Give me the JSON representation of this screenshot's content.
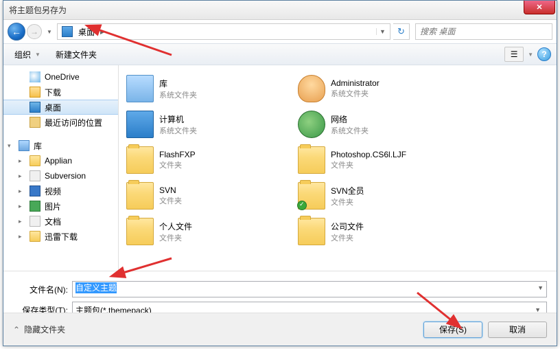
{
  "window": {
    "title": "将主题包另存为"
  },
  "nav": {
    "breadcrumb": "桌面",
    "search_placeholder": "搜索 桌面"
  },
  "toolbar": {
    "organize": "组织",
    "new_folder": "新建文件夹",
    "help": "?"
  },
  "sidebar": {
    "favorites": [
      {
        "label": "OneDrive",
        "icon": "cloud"
      },
      {
        "label": "下载",
        "icon": "down"
      },
      {
        "label": "桌面",
        "icon": "desk",
        "selected": true
      },
      {
        "label": "最近访问的位置",
        "icon": "recent"
      }
    ],
    "libraries_label": "库",
    "libraries": [
      {
        "label": "Applian",
        "icon": "folder"
      },
      {
        "label": "Subversion",
        "icon": "doc"
      },
      {
        "label": "视频",
        "icon": "vid"
      },
      {
        "label": "图片",
        "icon": "pic"
      },
      {
        "label": "文档",
        "icon": "doc"
      },
      {
        "label": "迅雷下载",
        "icon": "folder"
      }
    ]
  },
  "content": {
    "items": [
      {
        "name": "库",
        "sub": "系统文件夹",
        "icon": "lib"
      },
      {
        "name": "Administrator",
        "sub": "系统文件夹",
        "icon": "user"
      },
      {
        "name": "计算机",
        "sub": "系统文件夹",
        "icon": "comp"
      },
      {
        "name": "网络",
        "sub": "系统文件夹",
        "icon": "net"
      },
      {
        "name": "FlashFXP",
        "sub": "文件夹",
        "icon": "folder"
      },
      {
        "name": "Photoshop.CS6l.LJF",
        "sub": "文件夹",
        "icon": "folder"
      },
      {
        "name": "SVN",
        "sub": "文件夹",
        "icon": "folder"
      },
      {
        "name": "SVN全员",
        "sub": "文件夹",
        "icon": "folder",
        "badge": "check"
      },
      {
        "name": "个人文件",
        "sub": "文件夹",
        "icon": "folder"
      },
      {
        "name": "公司文件",
        "sub": "文件夹",
        "icon": "folder"
      }
    ]
  },
  "form": {
    "filename_label": "文件名(N):",
    "filename_value": "自定义主题",
    "type_label": "保存类型(T):",
    "type_value": "主题包(*.themepack)"
  },
  "footer": {
    "hide_folders": "隐藏文件夹",
    "save": "保存(S)",
    "cancel": "取消"
  }
}
